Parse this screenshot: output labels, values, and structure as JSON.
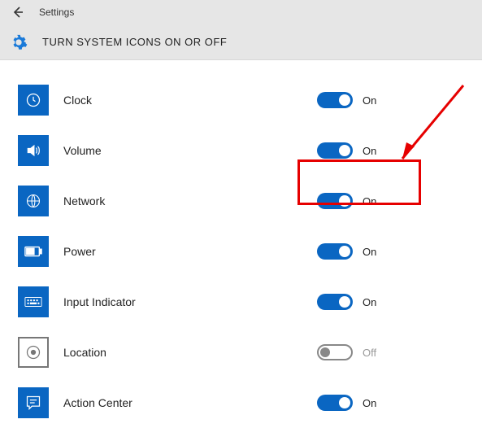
{
  "window": {
    "title": "Settings"
  },
  "page": {
    "title": "TURN SYSTEM ICONS ON OR OFF"
  },
  "states": {
    "on": "On",
    "off": "Off"
  },
  "items": [
    {
      "label": "Clock",
      "on": true
    },
    {
      "label": "Volume",
      "on": true
    },
    {
      "label": "Network",
      "on": true,
      "highlight": true
    },
    {
      "label": "Power",
      "on": true
    },
    {
      "label": "Input Indicator",
      "on": true
    },
    {
      "label": "Location",
      "on": false
    },
    {
      "label": "Action Center",
      "on": true
    }
  ],
  "colors": {
    "accent": "#0a66c2",
    "highlight": "#e60000"
  }
}
